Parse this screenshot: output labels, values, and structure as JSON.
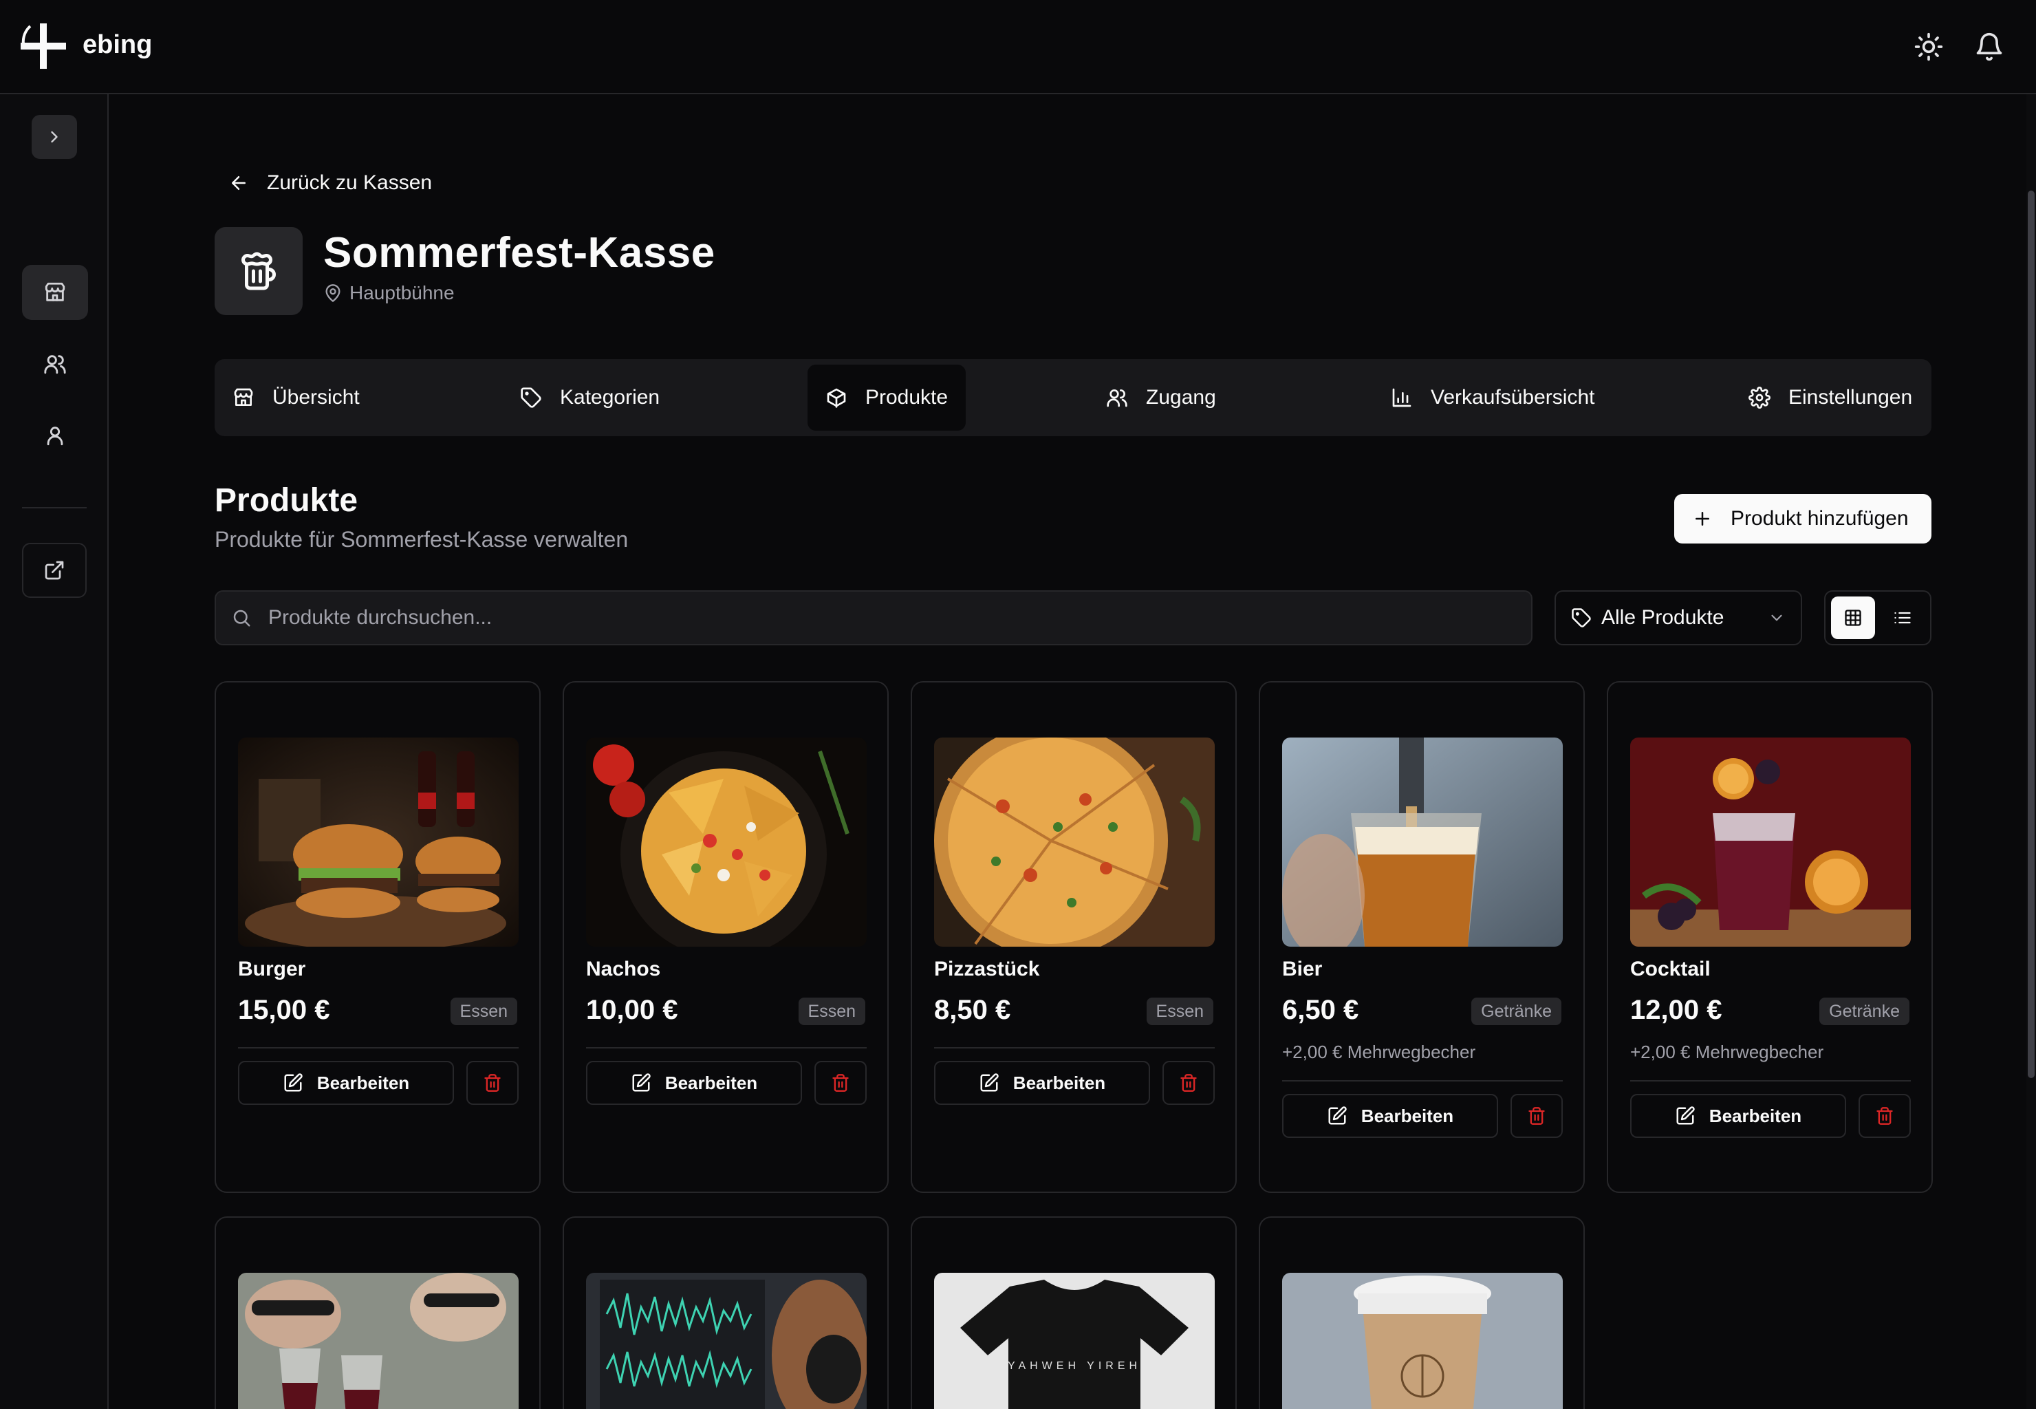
{
  "app": {
    "name": "ebing"
  },
  "header": {
    "theme_icon": "sun-icon",
    "notifications_icon": "bell-icon"
  },
  "sidebar": {
    "toggle_icon": "chevron-right-icon",
    "items": [
      {
        "name": "dashboard",
        "icon": "layout-grid-icon",
        "active": false
      },
      {
        "name": "stores",
        "icon": "store-icon",
        "active": true
      },
      {
        "name": "users",
        "icon": "users-icon",
        "active": false
      },
      {
        "name": "profile",
        "icon": "user-icon",
        "active": false
      }
    ],
    "external_icon": "external-link-icon"
  },
  "page": {
    "back_label": "Zurück zu Kassen",
    "title": "Sommerfest-Kasse",
    "location": "Hauptbühne",
    "tabs": [
      {
        "label": "Übersicht",
        "active": false
      },
      {
        "label": "Kategorien",
        "active": false
      },
      {
        "label": "Produkte",
        "active": true
      },
      {
        "label": "Zugang",
        "active": false
      },
      {
        "label": "Verkaufsübersicht",
        "active": false
      },
      {
        "label": "Einstellungen",
        "active": false
      }
    ]
  },
  "products_section": {
    "title": "Produkte",
    "subtitle": "Produkte für Sommerfest-Kasse verwalten",
    "add_button": "Produkt hinzufügen",
    "search_placeholder": "Produkte durchsuchen...",
    "filter_value": "Alle Produkte",
    "view_mode": "grid"
  },
  "products": [
    {
      "name": "Burger",
      "price": "15,00 €",
      "category": "Essen",
      "deposit": "",
      "edit_label": "Bearbeiten"
    },
    {
      "name": "Nachos",
      "price": "10,00 €",
      "category": "Essen",
      "deposit": "",
      "edit_label": "Bearbeiten"
    },
    {
      "name": "Pizzastück",
      "price": "8,50 €",
      "category": "Essen",
      "deposit": "",
      "edit_label": "Bearbeiten"
    },
    {
      "name": "Bier",
      "price": "6,50 €",
      "category": "Getränke",
      "deposit": "+2,00 € Mehrwegbecher",
      "edit_label": "Bearbeiten"
    },
    {
      "name": "Cocktail",
      "price": "12,00 €",
      "category": "Getränke",
      "deposit": "+2,00 € Mehrwegbecher",
      "edit_label": "Bearbeiten"
    }
  ],
  "colors": {
    "background": "#09090b",
    "surface": "#18181b",
    "border": "#27272a",
    "text": "#fafafa",
    "muted": "#a1a1aa",
    "danger": "#dc2626"
  }
}
